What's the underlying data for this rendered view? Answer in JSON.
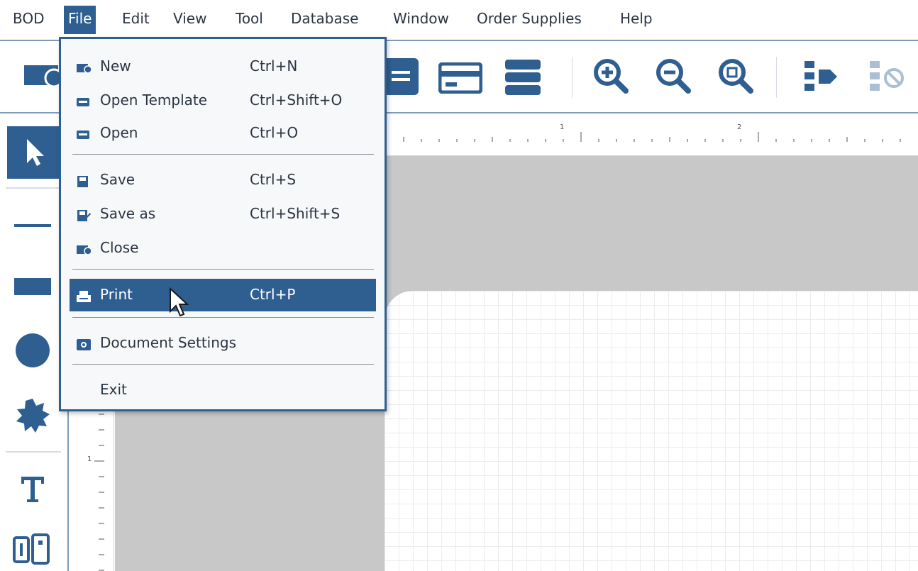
{
  "menubar": {
    "items": [
      {
        "label": "BOD"
      },
      {
        "label": "File"
      },
      {
        "label": "Edit"
      },
      {
        "label": "View"
      },
      {
        "label": "Tool"
      },
      {
        "label": "Database"
      },
      {
        "label": "Window"
      },
      {
        "label": "Order Supplies"
      },
      {
        "label": "Help"
      }
    ],
    "active": "File"
  },
  "file_menu": {
    "items": [
      {
        "label": "New",
        "shortcut": "Ctrl+N",
        "icon": "new-label-icon"
      },
      {
        "label": "Open Template",
        "shortcut": "Ctrl+Shift+O",
        "icon": "open-template-icon"
      },
      {
        "label": "Open",
        "shortcut": "Ctrl+O",
        "icon": "open-icon"
      },
      {
        "label": "Save",
        "shortcut": "Ctrl+S",
        "icon": "save-icon"
      },
      {
        "label": "Save as",
        "shortcut": "Ctrl+Shift+S",
        "icon": "save-as-icon"
      },
      {
        "label": "Close",
        "shortcut": "",
        "icon": "close-file-icon"
      },
      {
        "label": "Print",
        "shortcut": "Ctrl+P",
        "icon": "print-icon"
      },
      {
        "label": "Document Settings",
        "shortcut": "",
        "icon": "document-settings-icon"
      },
      {
        "label": "Exit",
        "shortcut": "",
        "icon": ""
      }
    ],
    "highlighted": "Print"
  },
  "hruler": {
    "marks": [
      "1",
      "2"
    ]
  },
  "vruler": {
    "marks": [
      "1"
    ]
  },
  "colors": {
    "accent": "#2f5f91",
    "canvas_bg": "#c8c8c8",
    "grid": "#ececec"
  }
}
